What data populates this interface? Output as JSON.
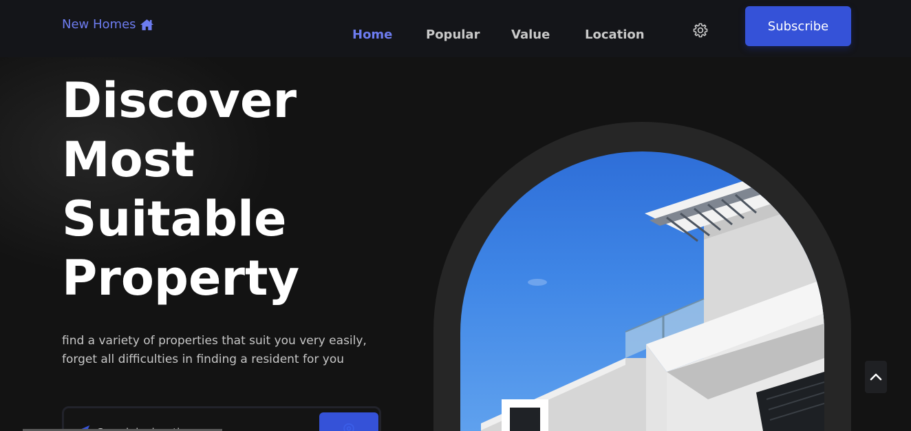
{
  "header": {
    "logo_text": "New Homes",
    "logo_icon": "home-icon",
    "nav": [
      {
        "label": "Home",
        "active": true
      },
      {
        "label": "Popular",
        "active": false
      },
      {
        "label": "Value",
        "active": false
      },
      {
        "label": "Location",
        "active": false
      }
    ],
    "settings_icon": "gear-icon",
    "subscribe_label": "Subscribe"
  },
  "hero": {
    "title_lines": [
      "Discover",
      "Most",
      "Suitable",
      "Property"
    ],
    "subtitle": "find a variety of properties that suit you very easily, forget all difficulties in finding a resident for you",
    "search": {
      "placeholder": "Search by location",
      "icon": "location-arrow-icon",
      "button_icon": "location-pin-icon"
    }
  },
  "colors": {
    "accent": "#3552d8",
    "accent_text": "#6d7cf0",
    "background": "#131313",
    "header_bg": "#141519"
  },
  "scroll_top_icon": "chevron-up-icon"
}
